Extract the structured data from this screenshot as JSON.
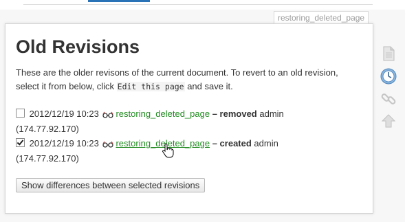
{
  "page_tab": "restoring_deleted_page",
  "title": "Old Revisions",
  "intro": {
    "text_before": "These are the older revisons of the current document. To revert to an old revision, select it from below, click ",
    "code": "Edit this page",
    "text_after": " and save it."
  },
  "revisions": [
    {
      "checked": false,
      "date": "2012/12/19 10:23",
      "page": "restoring_deleted_page",
      "summary": "– removed",
      "user": "admin",
      "ip": "(174.77.92.170)"
    },
    {
      "checked": true,
      "date": "2012/12/19 10:23",
      "page": "restoring_deleted_page",
      "summary": "– created",
      "user": "admin",
      "ip": "(174.77.92.170)"
    }
  ],
  "diff_button": "Show differences between selected revisions",
  "side_tools": [
    "document-icon",
    "clock-icon",
    "chain-link-icon",
    "arrow-up-icon"
  ],
  "colors": {
    "link": "#228b22",
    "accent_blue": "#2b73b7"
  }
}
